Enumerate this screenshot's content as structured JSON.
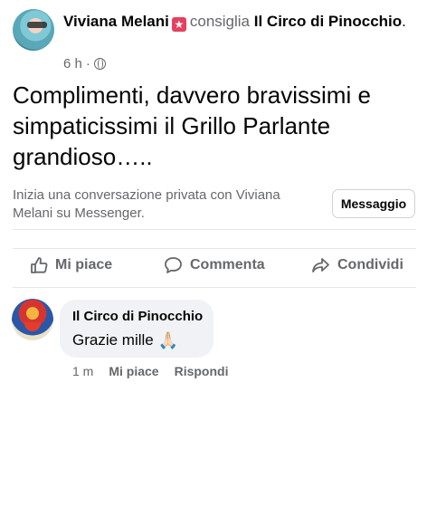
{
  "post": {
    "author": "Viviana Melani",
    "author_badge_icon": "star-badge-icon",
    "verb": "consiglia",
    "page": "Il Circo di Pinocchio",
    "page_suffix": ".",
    "time": "6 h",
    "separator": "·",
    "privacy_icon": "globe-icon",
    "text": "Complimenti, davvero bravissimi e simpaticissimi il Grillo Parlante grandioso….."
  },
  "messenger": {
    "prompt": "Inizia una conversazione privata con Viviana Melani su Messenger.",
    "button_label": "Messaggio"
  },
  "actions": {
    "like_label": "Mi piace",
    "comment_label": "Commenta",
    "share_label": "Condividi"
  },
  "comment": {
    "author": "Il Circo di Pinocchio",
    "text": "Grazie mille",
    "emoji": "🙏🏻",
    "time": "1 m",
    "like_label": "Mi piace",
    "reply_label": "Rispondi"
  },
  "colors": {
    "text": "#050505",
    "secondary": "#65676b",
    "bubble": "#f0f2f5",
    "badge": "#e4405f"
  }
}
